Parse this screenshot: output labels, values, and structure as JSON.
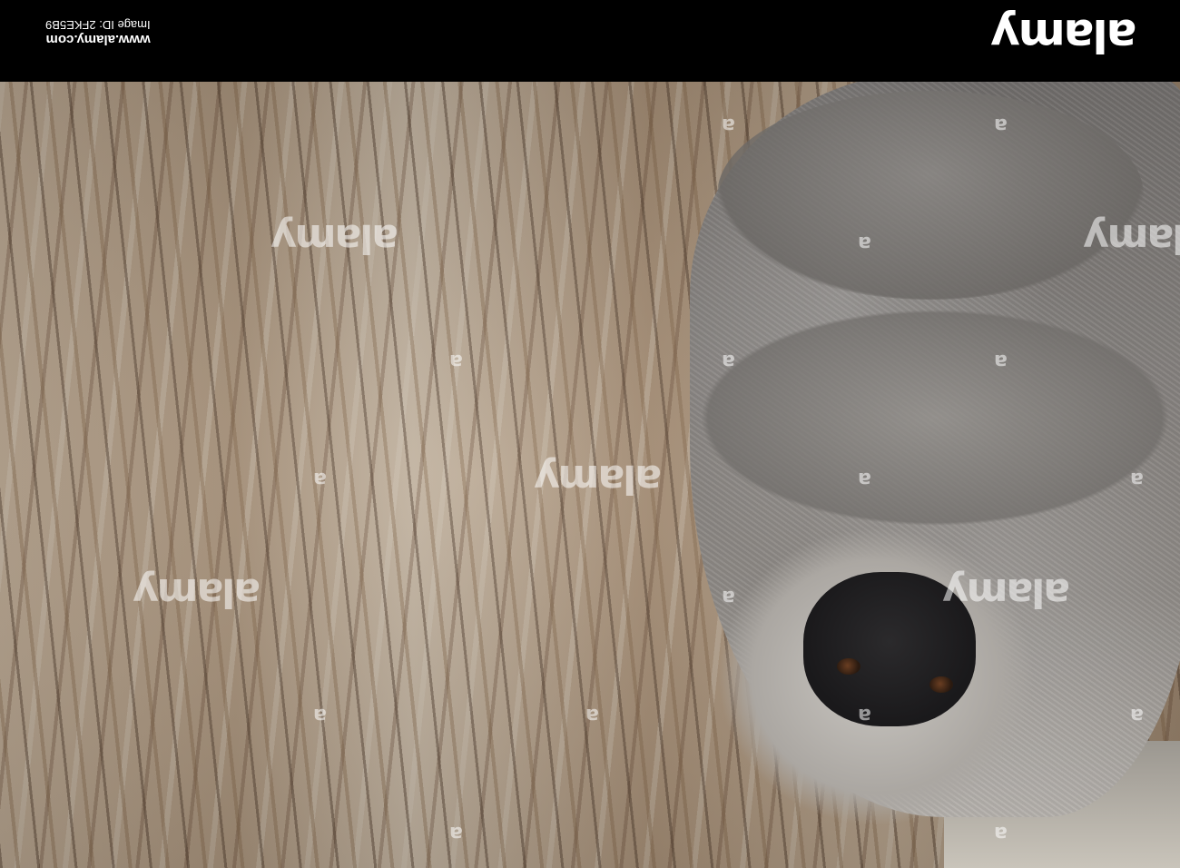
{
  "banner": {
    "logo": "alamy",
    "image_id": "Image ID: 2FKE5B9",
    "url": "www.alamy.com"
  },
  "watermarks": {
    "text": "alamy",
    "mark": "a"
  }
}
